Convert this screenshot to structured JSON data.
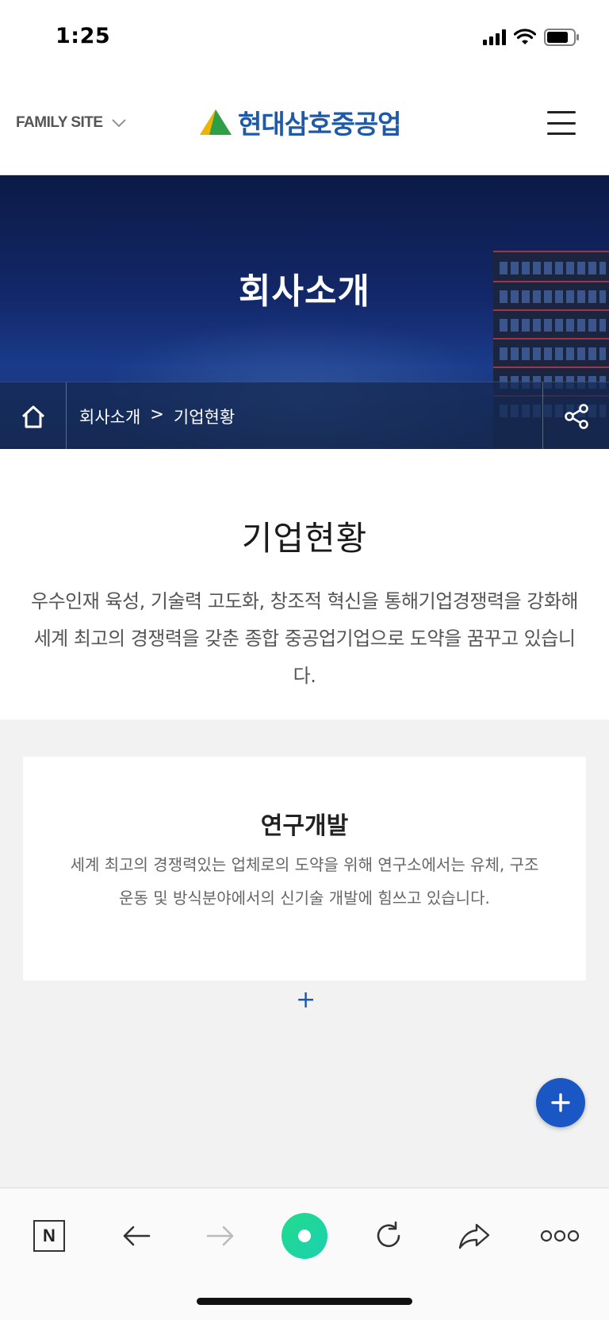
{
  "status_bar": {
    "time": "1:25",
    "signal_icon": "cellular-signal-icon",
    "wifi_icon": "wifi-icon",
    "battery_icon": "battery-icon"
  },
  "header": {
    "family_site_label": "FAMILY SITE",
    "logo_text": "현대삼호중공업",
    "menu_icon": "hamburger-menu-icon"
  },
  "hero": {
    "title": "회사소개",
    "breadcrumb": {
      "home_icon": "home-icon",
      "items": [
        "회사소개",
        "기업현황"
      ],
      "separator": ">",
      "share_icon": "share-icon"
    }
  },
  "main": {
    "title": "기업현황",
    "description": "우수인재 육성, 기술력 고도화, 창조적 혁신을 통해기업경쟁력을 강화해 세계 최고의 경쟁력을 갖춘 종합 중공업기업으로 도약을 꿈꾸고 있습니다."
  },
  "card": {
    "title": "연구개발",
    "text": "세계 최고의 경쟁력있는 업체로의 도약을 위해 연구소에서는 유체, 구조 운동 및 방식분야에서의 신기술 개발에 힘쓰고 있습니다.",
    "more_symbol": "+"
  },
  "fab": {
    "symbol": "+"
  },
  "toolbar": {
    "n_label": "N",
    "icons": [
      "naver-n-icon",
      "back-arrow-icon",
      "forward-arrow-icon",
      "green-dot-icon",
      "reload-icon",
      "share-arrow-icon",
      "more-dots-icon"
    ]
  },
  "colors": {
    "brand_blue": "#1e5aa8",
    "fab_blue": "#1a56c4",
    "gray_section": "#f2f2f2",
    "green_dot": "#1fdc8c"
  }
}
